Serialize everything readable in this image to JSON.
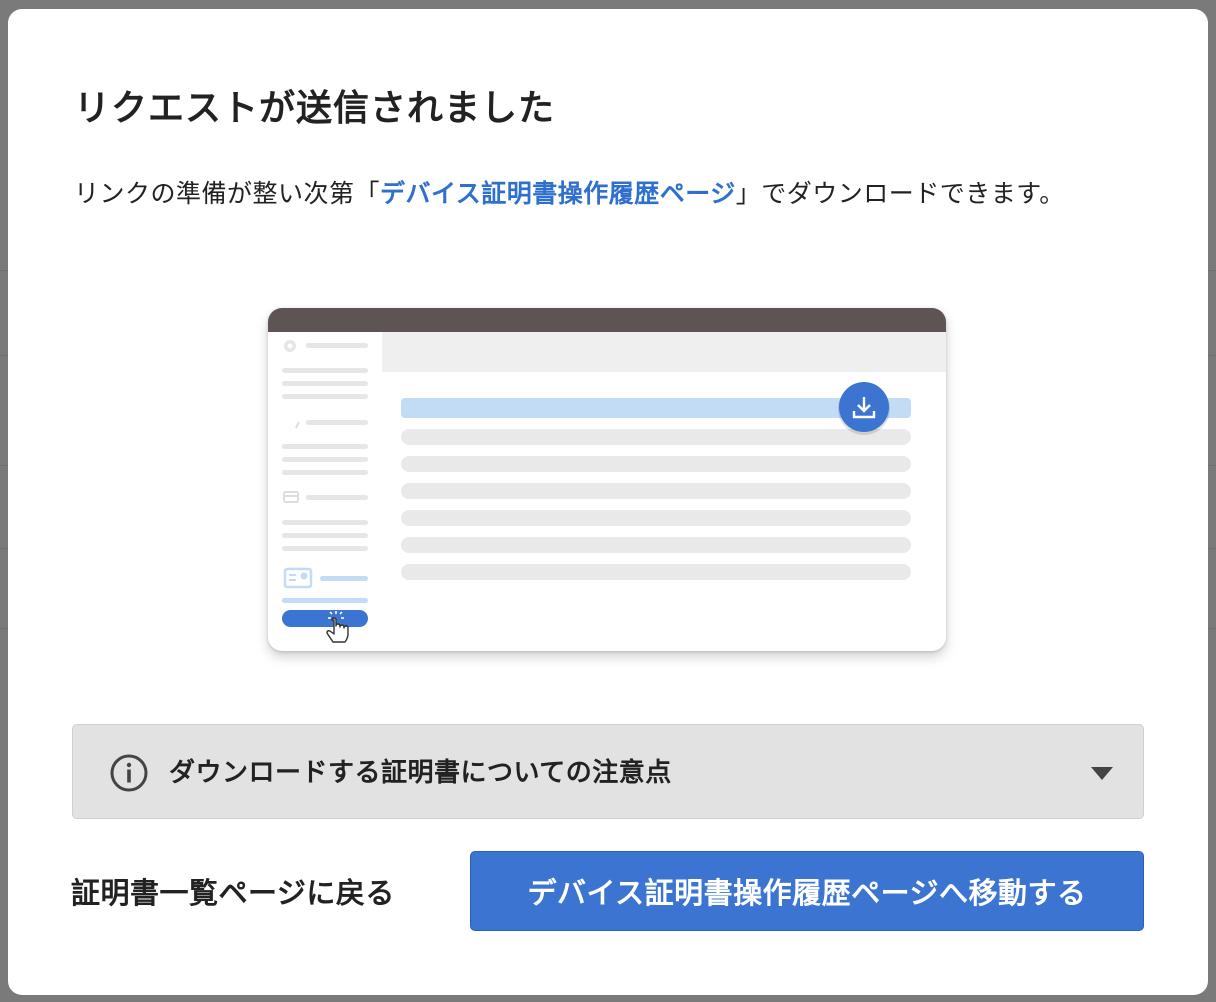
{
  "dialog": {
    "title": "リクエストが送信されました",
    "description_before": "リンクの準備が整い次第「",
    "description_link": "デバイス証明書操作履歴ページ",
    "description_after": "」でダウンロードできます。"
  },
  "illustration": {
    "icons": [
      "gear-icon",
      "pin-icon",
      "card-icon",
      "certificate-icon",
      "download-icon",
      "pointer-hand-icon"
    ]
  },
  "notice": {
    "label": "ダウンロードする証明書についての注意点",
    "icons": [
      "info-icon",
      "chevron-down-icon"
    ]
  },
  "footer": {
    "back_label": "証明書一覧ページに戻る",
    "primary_label": "デバイス証明書操作履歴ページへ移動する"
  },
  "colors": {
    "accent": "#3c74d1",
    "link": "#2f6fce",
    "overlay": "#7a7a7a",
    "illustration_header": "#5e5453",
    "highlight_row": "#c2dcf5"
  }
}
